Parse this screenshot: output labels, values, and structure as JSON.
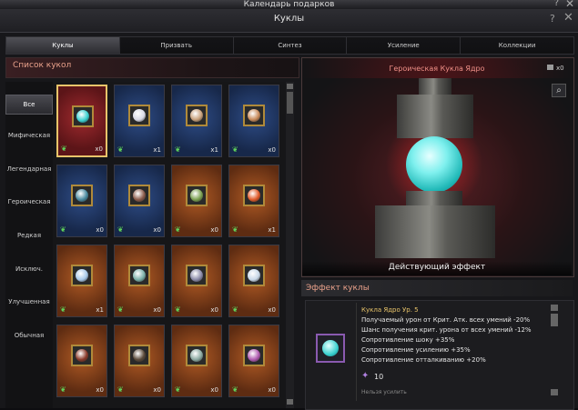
{
  "top": {
    "title": "Календарь подарков",
    "help": "?",
    "close": "✕"
  },
  "window": {
    "title": "Куклы",
    "help": "?",
    "close": "✕"
  },
  "tabs": [
    "Куклы",
    "Призвать",
    "Синтез",
    "Усиление",
    "Коллекции"
  ],
  "list_header": "Список кукол",
  "categories": [
    "Все",
    "Мифическая",
    "Легендарная",
    "Героическая",
    "Редкая",
    "Исключ.",
    "Улучшенная",
    "Обычная"
  ],
  "cards": [
    {
      "rarity": "red",
      "count": "x0",
      "color": "#3ad0cf"
    },
    {
      "rarity": "blue",
      "count": "x1",
      "color": "#d9d9e6"
    },
    {
      "rarity": "blue",
      "count": "x1",
      "color": "#c8a07a"
    },
    {
      "rarity": "blue",
      "count": "x0",
      "color": "#c88a5a"
    },
    {
      "rarity": "blue",
      "count": "x0",
      "color": "#4a8aa0"
    },
    {
      "rarity": "blue",
      "count": "x0",
      "color": "#8a5a4a"
    },
    {
      "rarity": "orange",
      "count": "x0",
      "color": "#7aa050"
    },
    {
      "rarity": "orange",
      "count": "x1",
      "color": "#e05a2a"
    },
    {
      "rarity": "orange",
      "count": "x1",
      "color": "#a8c8e8"
    },
    {
      "rarity": "orange",
      "count": "x0",
      "color": "#7ab0a8"
    },
    {
      "rarity": "orange",
      "count": "x0",
      "color": "#8a8aa8"
    },
    {
      "rarity": "orange",
      "count": "x0",
      "color": "#c8d8e8"
    },
    {
      "rarity": "orange",
      "count": "x0",
      "color": "#8a3a2a"
    },
    {
      "rarity": "orange",
      "count": "x0",
      "color": "#5a4a3a"
    },
    {
      "rarity": "orange",
      "count": "x0",
      "color": "#8aa8a0"
    },
    {
      "rarity": "orange",
      "count": "x0",
      "color": "#b05ab0"
    }
  ],
  "detail": {
    "title": "Героическая Кукла Ядро",
    "stat_value": "x0",
    "effect_label": "Действующий эффект"
  },
  "effect": {
    "header": "Эффект куклы",
    "name": "Кукла Ядро Ур. 5",
    "lines": [
      "Получаемый урон от Крит. Атк. всех умений -20%",
      "Шанс получения крит. урона от всех умений -12%",
      "Сопротивление шоку +35%",
      "Сопротивление усилению +35%",
      "Сопротивление отталкиванию +20%"
    ],
    "gem_value": "10",
    "note": "Нельзя усилить"
  },
  "colors": {
    "accent": "#e8a08a",
    "selected_border": "#e8c46a",
    "orb": "#3ad0cf"
  }
}
